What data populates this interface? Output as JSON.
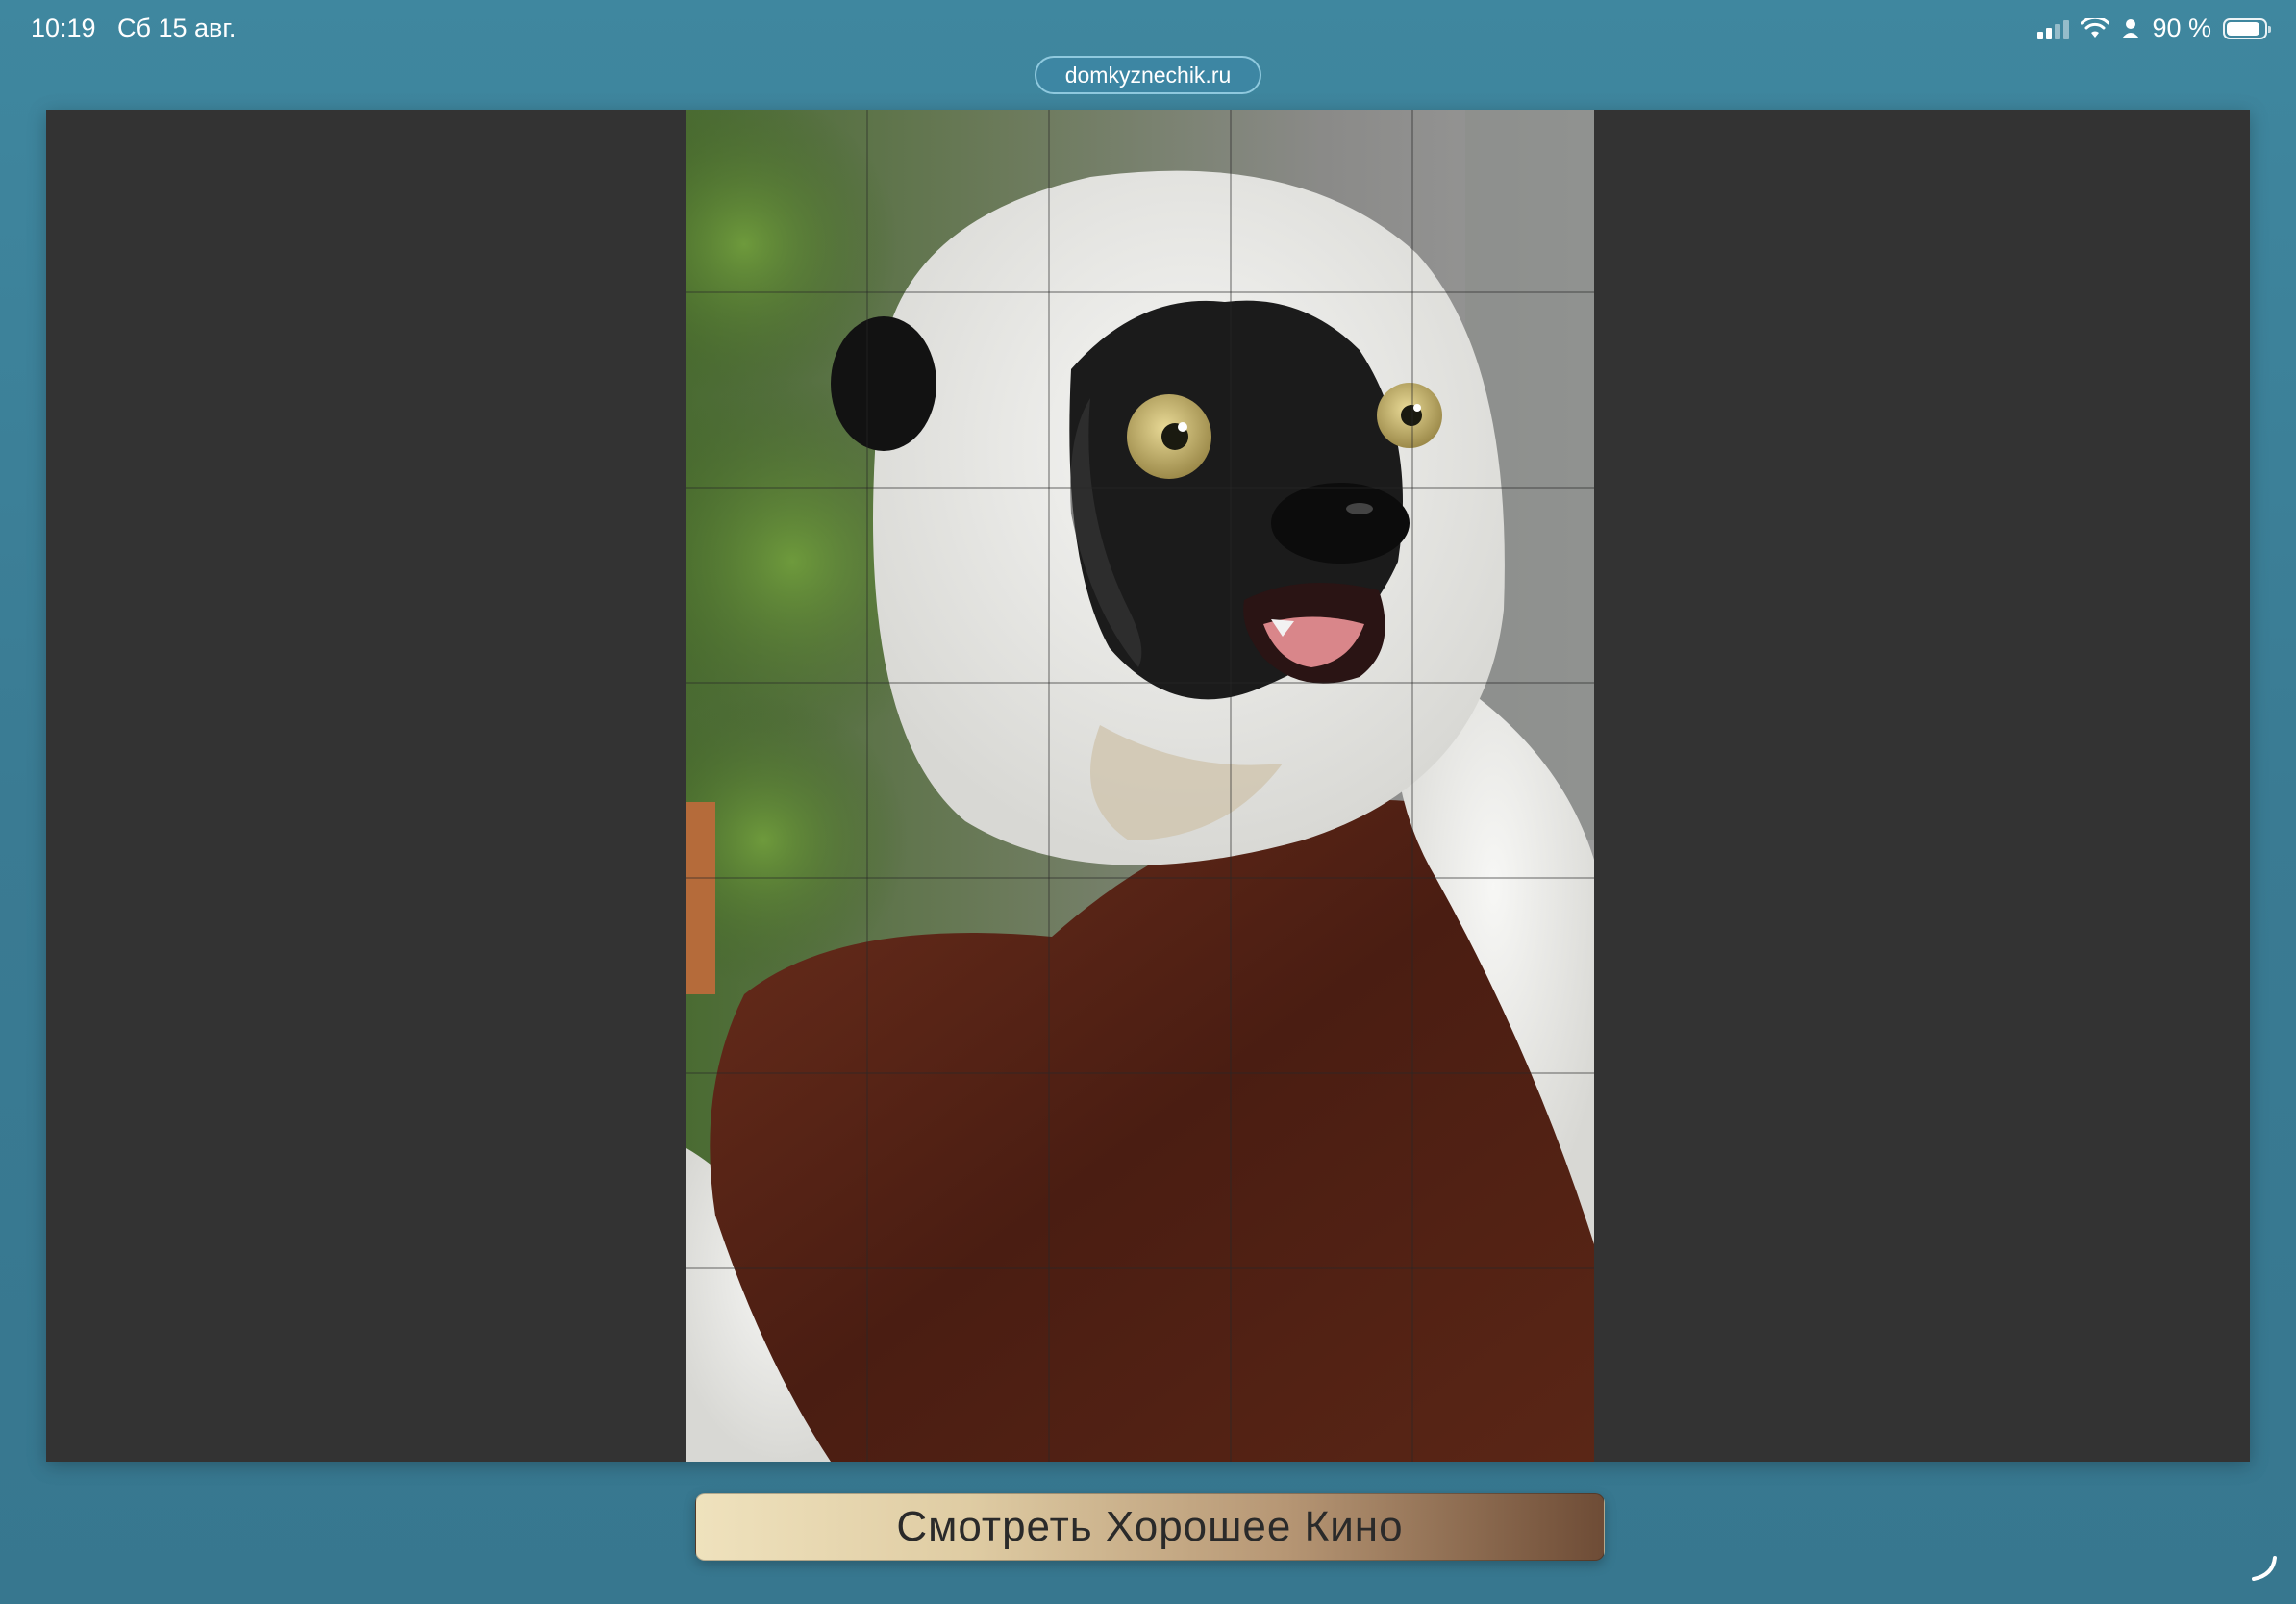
{
  "status_bar": {
    "time": "10:19",
    "date": "Сб 15 авг.",
    "battery_percent": "90 %",
    "battery_level": 0.9,
    "icons": [
      "signal-icon",
      "wifi-icon",
      "person-icon",
      "battery-icon"
    ]
  },
  "browser": {
    "url": "domkyznechik.ru"
  },
  "puzzle": {
    "image_subject": "lemur-photo",
    "grid_columns": 5,
    "grid_rows": 7
  },
  "cta": {
    "label": "Смотреть Хорошее Кино"
  },
  "colors": {
    "background": "#3d7f99",
    "stage": "#333333",
    "button_light": "#efe2bd",
    "button_dark": "#6e4c36"
  }
}
